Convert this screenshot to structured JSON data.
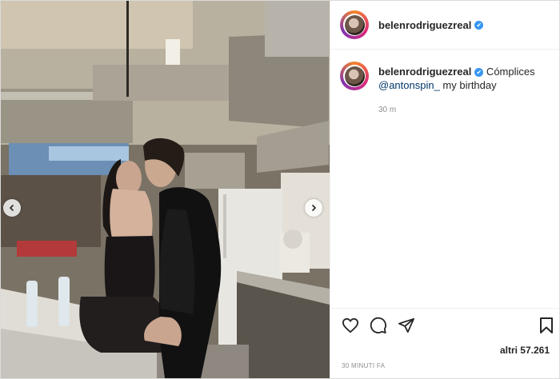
{
  "post": {
    "username": "belenrodriguezreal",
    "caption_text": " Cómplices ",
    "mention": "@antonspin_",
    "caption_tail": " my birthday",
    "comment_time": "30 m",
    "likes": "altri 57.261",
    "time_ago": "30 MINUTI FA"
  },
  "icons": {
    "verified": "✔",
    "carousel_prev": "chevron-left-icon",
    "carousel_next": "chevron-right-icon",
    "like": "heart-icon",
    "comment": "comment-icon",
    "share": "paper-plane-icon",
    "save": "bookmark-icon"
  },
  "colors": {
    "text": "#262626",
    "muted": "#8e8e8e",
    "link": "#00376b",
    "verified": "#3897f0"
  }
}
